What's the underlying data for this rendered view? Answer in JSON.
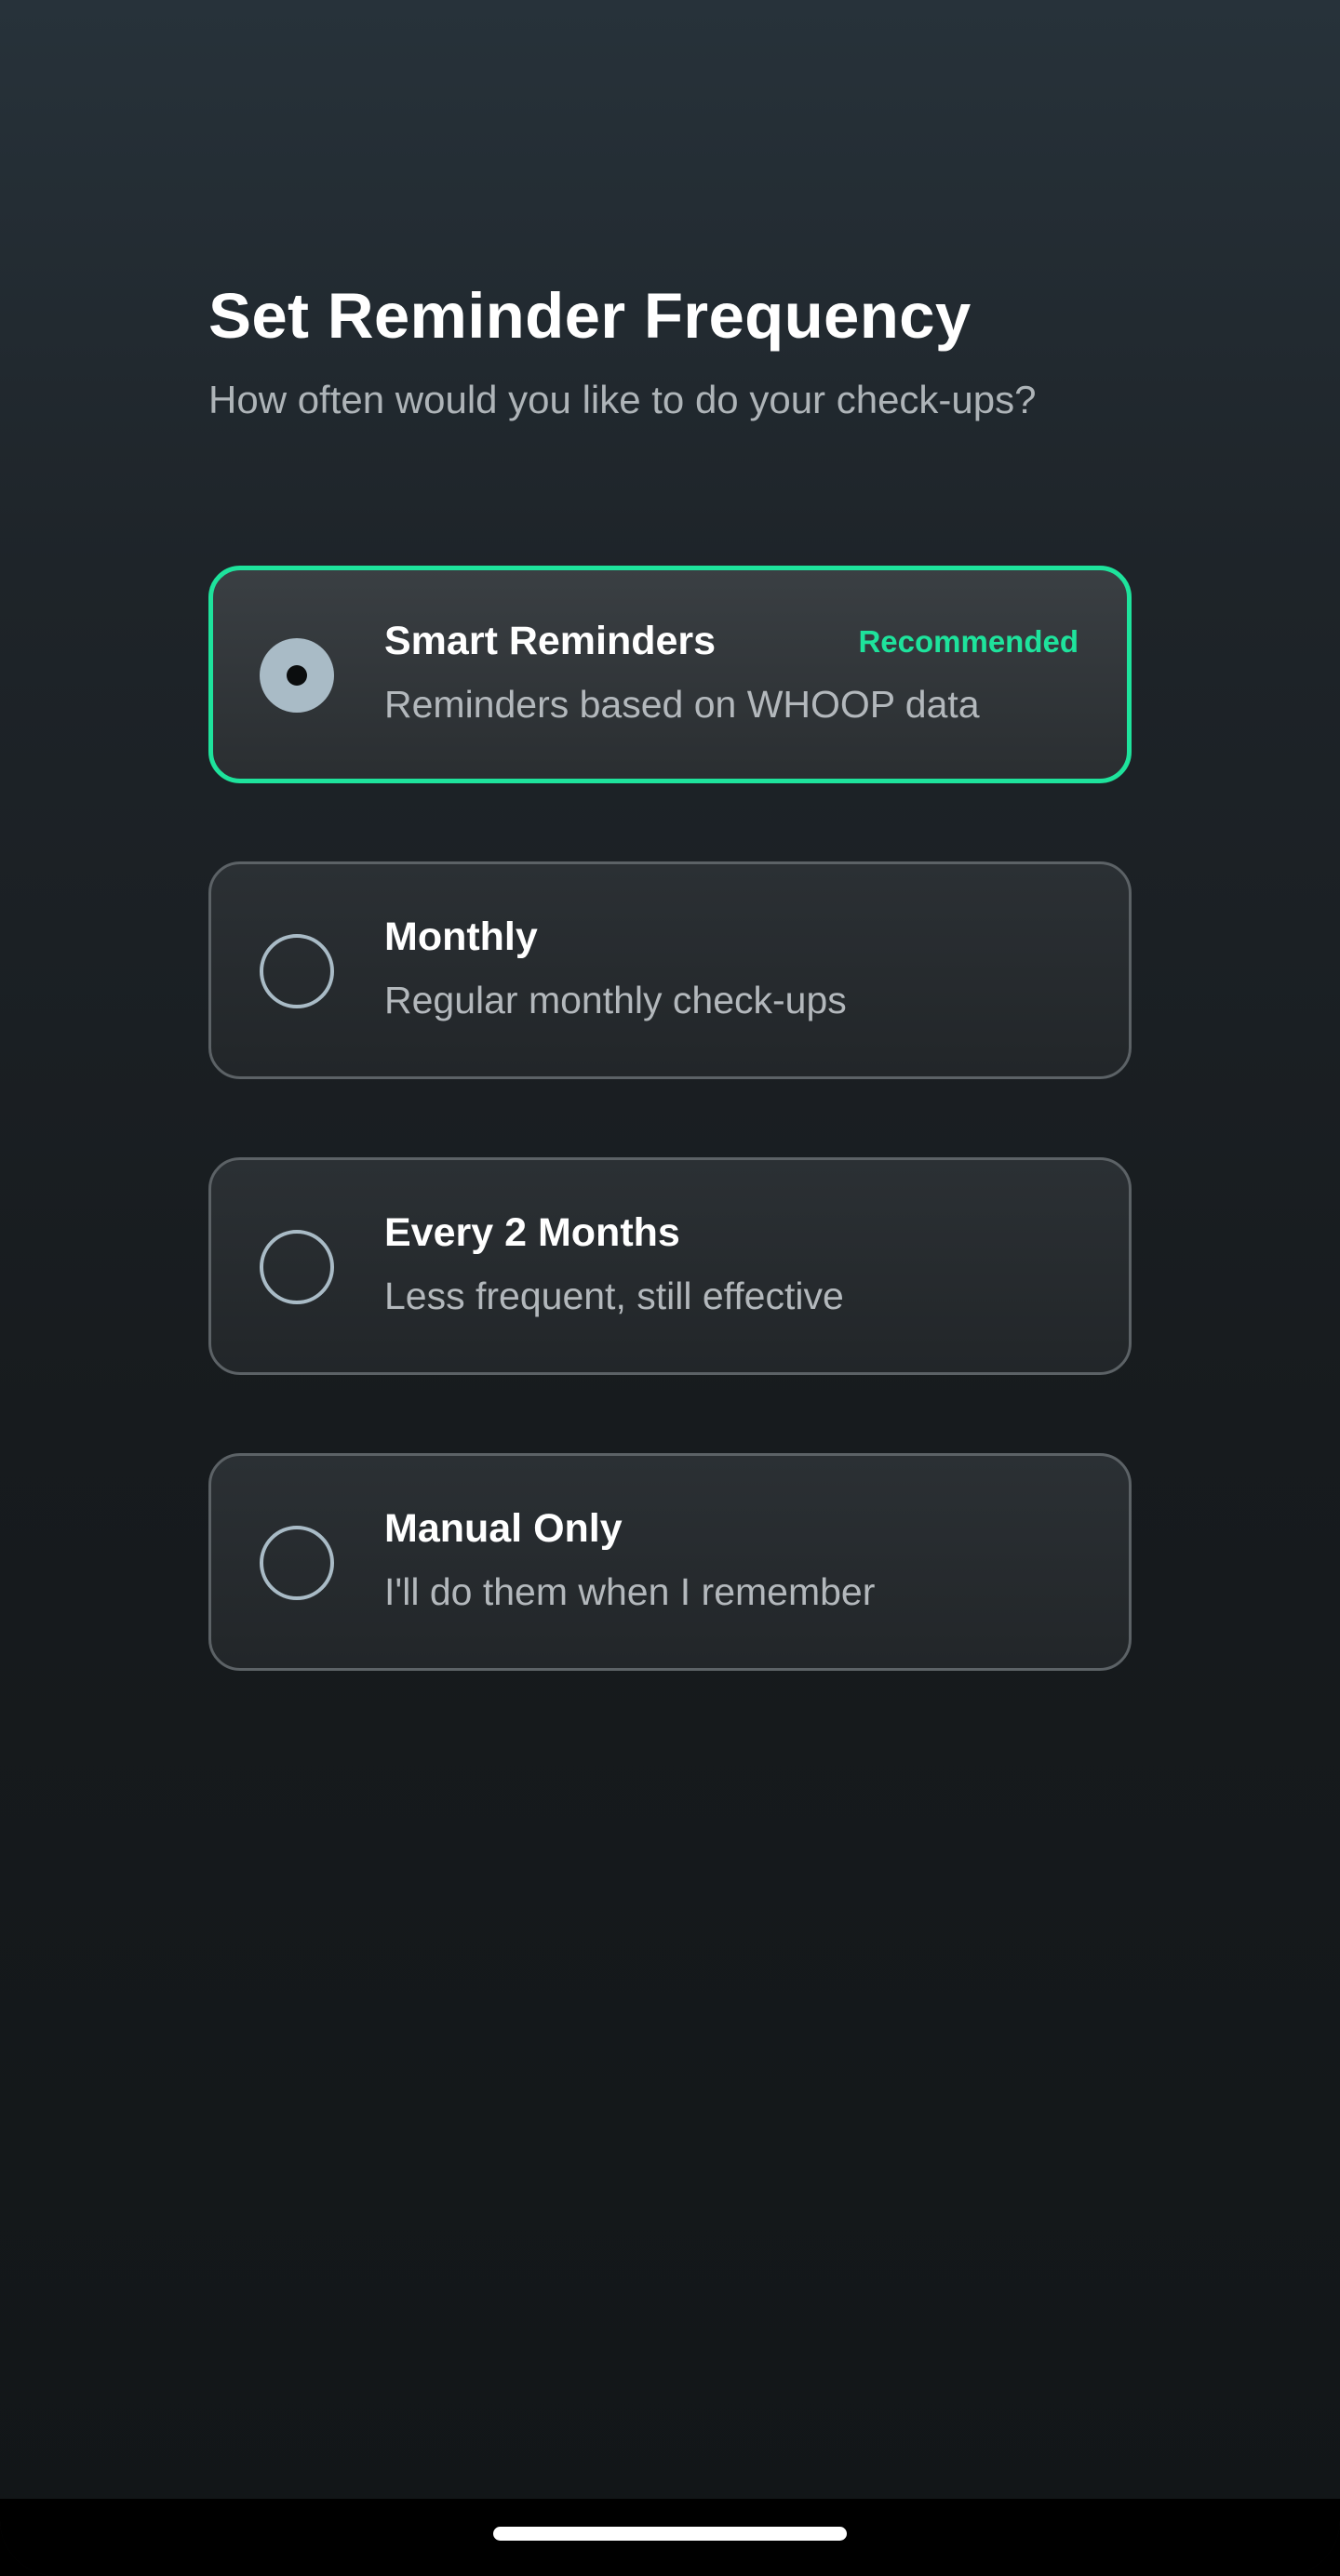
{
  "header": {
    "title": "Set Reminder Frequency",
    "subtitle": "How often would you like to do your check-ups?"
  },
  "options": [
    {
      "title": "Smart Reminders",
      "description": "Reminders based on WHOOP data",
      "badge": "Recommended",
      "selected": true
    },
    {
      "title": "Monthly",
      "description": "Regular monthly check-ups",
      "selected": false
    },
    {
      "title": "Every 2 Months",
      "description": "Less frequent, still effective",
      "selected": false
    },
    {
      "title": "Manual Only",
      "description": "I'll do them when I remember",
      "selected": false
    }
  ],
  "colors": {
    "accent": "#1ee39c",
    "radio": "#a9bbc6",
    "background_top": "#27323a",
    "background_bottom": "#121618"
  }
}
